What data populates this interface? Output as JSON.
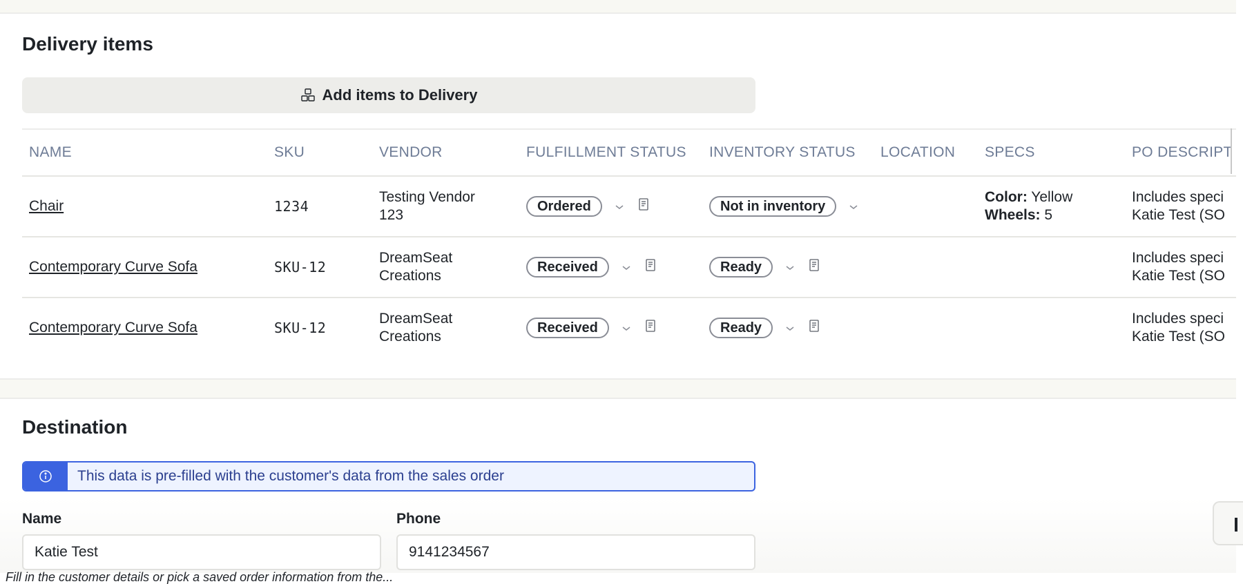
{
  "delivery_items": {
    "title": "Delivery items",
    "add_button_label": "Add items to Delivery",
    "columns": [
      "NAME",
      "SKU",
      "VENDOR",
      "FULFILLMENT STATUS",
      "INVENTORY STATUS",
      "LOCATION",
      "SPECS",
      "PO DESCRIPT"
    ],
    "rows": [
      {
        "name": "Chair",
        "sku": "1234",
        "vendor_line1": "Testing Vendor",
        "vendor_line2": "123",
        "fulfillment_status": "Ordered",
        "inventory_status": "Not in inventory",
        "location": "",
        "spec1_label": "Color:",
        "spec1_value": "Yellow",
        "spec2_label": "Wheels:",
        "spec2_value": "5",
        "po_line1": "Includes speci",
        "po_line2": "Katie Test (SO"
      },
      {
        "name": "Contemporary Curve Sofa",
        "sku": "SKU-12",
        "vendor_line1": "DreamSeat",
        "vendor_line2": "Creations",
        "fulfillment_status": "Received",
        "inventory_status": "Ready",
        "location": "",
        "spec1_label": "",
        "spec1_value": "",
        "spec2_label": "",
        "spec2_value": "",
        "po_line1": "Includes speci",
        "po_line2": "Katie Test (SO"
      },
      {
        "name": "Contemporary Curve Sofa",
        "sku": "SKU-12",
        "vendor_line1": "DreamSeat",
        "vendor_line2": "Creations",
        "fulfillment_status": "Received",
        "inventory_status": "Ready",
        "location": "",
        "spec1_label": "",
        "spec1_value": "",
        "spec2_label": "",
        "spec2_value": "",
        "po_line1": "Includes speci",
        "po_line2": "Katie Test (SO"
      }
    ]
  },
  "destination": {
    "title": "Destination",
    "info_banner": "This data is pre-filled with the customer's data from the sales order",
    "name_label": "Name",
    "name_value": "Katie Test",
    "phone_label": "Phone",
    "phone_value": "9141234567"
  },
  "footer_cutoff_text": "Fill in the customer details or pick a saved order information from the...",
  "colors": {
    "accent_blue": "#3b63e0",
    "banner_bg": "#eef3ff",
    "header_text": "#6e7c96",
    "button_bg": "#ededea"
  },
  "icons": {
    "add_button": "cubes-icon",
    "status_dropdown": "chevron-down-icon",
    "status_note": "note-icon",
    "info": "info-icon"
  }
}
